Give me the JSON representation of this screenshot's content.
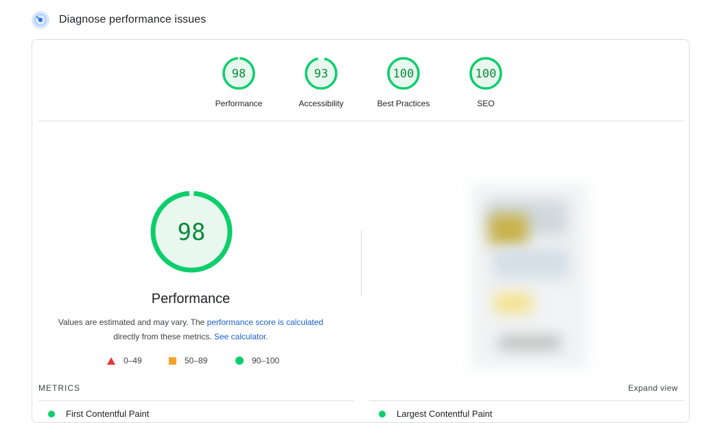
{
  "header": {
    "title": "Diagnose performance issues"
  },
  "colors": {
    "pass": "#0cce6b",
    "pass_text": "#0c8a3c",
    "average": "#f4a329",
    "fail": "#e8343a",
    "link": "#1a5fd0"
  },
  "categories": [
    {
      "label": "Performance",
      "score": "98",
      "value": 98
    },
    {
      "label": "Accessibility",
      "score": "93",
      "value": 93
    },
    {
      "label": "Best Practices",
      "score": "100",
      "value": 100
    },
    {
      "label": "SEO",
      "score": "100",
      "value": 100
    }
  ],
  "main": {
    "score": "98",
    "value": 98,
    "title": "Performance",
    "desc_prefix": "Values are estimated and may vary. The ",
    "desc_link1": "performance score is calculated",
    "desc_mid": "directly from these metrics. ",
    "desc_link2": "See calculator",
    "desc_suffix": "."
  },
  "legend": [
    {
      "shape": "triangle",
      "range": "0–49"
    },
    {
      "shape": "square",
      "range": "50–89"
    },
    {
      "shape": "circle",
      "range": "90–100"
    }
  ],
  "metrics": {
    "label": "METRICS",
    "expand": "Expand view",
    "items": [
      "First Contentful Paint",
      "Largest Contentful Paint"
    ]
  }
}
